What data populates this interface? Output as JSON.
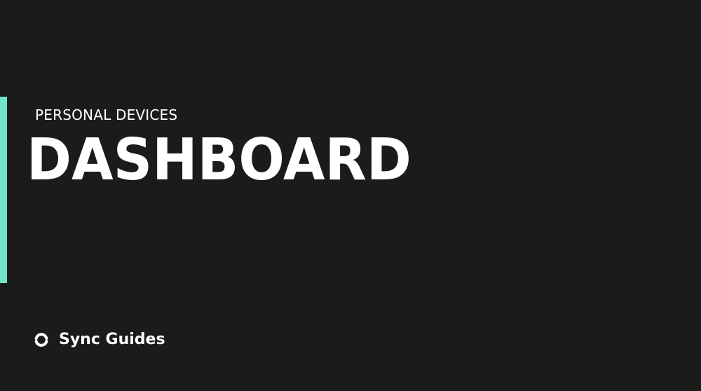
{
  "header": {
    "subtitle": "PERSONAL DEVICES",
    "title": "DASHBOARD"
  },
  "brand": {
    "name": "Sync Guides",
    "icon": "sync-logo-icon"
  },
  "colors": {
    "background": "#1b1b1b",
    "accent": "#6fe6c9",
    "text": "#ffffff"
  }
}
